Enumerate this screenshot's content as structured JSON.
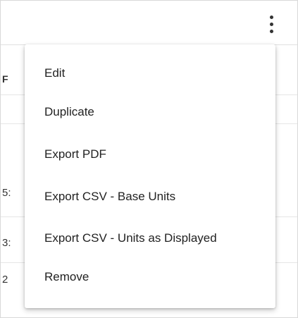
{
  "header": {
    "more_icon": "kebab-vertical-icon"
  },
  "table": {
    "header_partial": "F",
    "row_partials": [
      "",
      "5:",
      "3:",
      "2"
    ]
  },
  "menu": {
    "items": [
      {
        "label": "Edit"
      },
      {
        "label": "Duplicate"
      },
      {
        "label": "Export PDF"
      },
      {
        "label": "Export CSV - Base Units"
      },
      {
        "label": "Export CSV - Units as Displayed"
      },
      {
        "label": "Remove"
      }
    ]
  }
}
